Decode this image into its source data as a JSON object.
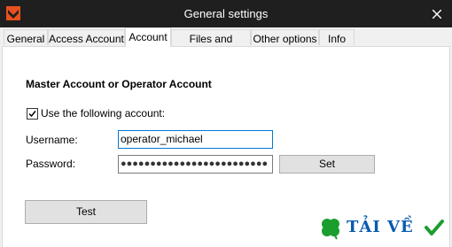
{
  "window": {
    "title": "General settings",
    "close_glyph": "✕"
  },
  "tabs": [
    {
      "label": "General"
    },
    {
      "label": "Access Account"
    },
    {
      "label": "Account"
    },
    {
      "label": "Files and folders"
    },
    {
      "label": "Other options"
    },
    {
      "label": "Info"
    }
  ],
  "active_tab": "Account",
  "account": {
    "heading": "Master Account or Operator Account",
    "use_account_label": "Use the following account:",
    "use_account_checked": true,
    "username_label": "Username:",
    "username_value": "operator_michael",
    "password_label": "Password:",
    "password_mask": "●●●●●●●●●●●●●●●●●●●●●●●●●",
    "set_button": "Set",
    "test_button": "Test"
  },
  "watermark": {
    "text": "TẢI VỀ"
  },
  "colors": {
    "titlebar": "#1f1f1f",
    "app_icon": "#e8501e",
    "focus_border": "#0078d7",
    "watermark_text": "#0a5bb0",
    "watermark_green": "#1a9e2f"
  }
}
